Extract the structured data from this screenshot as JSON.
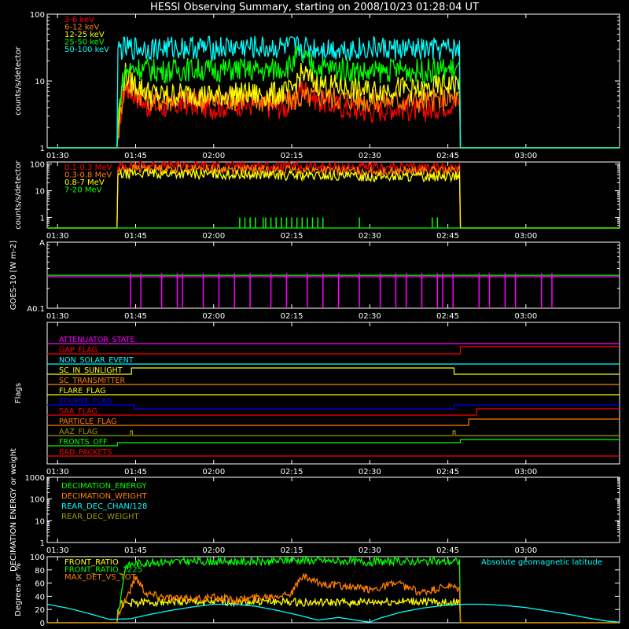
{
  "title": "HESSI Observing Summary, starting on 2008/10/23 01:28:04 UT",
  "time_axis": {
    "start_min": 88,
    "end_min": 198,
    "ticks": [
      {
        "label": "01:30",
        "min": 90
      },
      {
        "label": "01:45",
        "min": 105
      },
      {
        "label": "02:00",
        "min": 120
      },
      {
        "label": "02:15",
        "min": 135
      },
      {
        "label": "02:30",
        "min": 150
      },
      {
        "label": "02:45",
        "min": 165
      },
      {
        "label": "03:00",
        "min": 180
      }
    ]
  },
  "chart_data": [
    {
      "id": "count-rates-low",
      "type": "line",
      "ylabel": "counts/s/detector",
      "yscale": "log",
      "ylim": [
        1,
        100
      ],
      "yticks": [
        {
          "label": "1",
          "v": 1
        },
        {
          "label": "10",
          "v": 10
        },
        {
          "label": "100",
          "v": 100
        }
      ],
      "legend_placement": "top-left",
      "series": [
        {
          "name": "3-6 keV",
          "color": "#ff0000",
          "x": [
            88,
            101.5,
            101.6,
            102,
            103,
            104,
            105,
            106,
            107,
            108,
            110,
            115,
            120,
            125,
            130,
            135,
            137,
            140,
            145,
            150,
            155,
            160,
            165,
            167.3,
            167.4,
            198
          ],
          "y": [
            1,
            1,
            1.5,
            2.5,
            8,
            7,
            6,
            5.5,
            4,
            4.5,
            4,
            4.5,
            4,
            4.5,
            4.2,
            4,
            8,
            5,
            4,
            3.5,
            4,
            3.5,
            4.5,
            5,
            1,
            1
          ]
        },
        {
          "name": "6-12 keV",
          "color": "#ff7f00",
          "x": [
            88,
            101.5,
            101.6,
            102,
            103,
            104,
            105,
            107,
            110,
            115,
            120,
            125,
            130,
            135,
            140,
            145,
            150,
            155,
            160,
            165,
            167.3,
            167.4,
            198
          ],
          "y": [
            1,
            1,
            1.5,
            2.5,
            9,
            8,
            7,
            5.5,
            5,
            5.5,
            5,
            5.5,
            5,
            5.2,
            6,
            5.5,
            5,
            5.2,
            5,
            5.5,
            5.5,
            1,
            1
          ]
        },
        {
          "name": "12-25 keV",
          "color": "#ffff00",
          "x": [
            88,
            101.5,
            101.6,
            102,
            103,
            104,
            105,
            107,
            110,
            115,
            120,
            125,
            130,
            135,
            137,
            140,
            145,
            150,
            155,
            160,
            165,
            167.3,
            167.4,
            198
          ],
          "y": [
            1,
            1,
            2,
            4,
            13,
            10,
            9,
            7,
            6,
            6.5,
            6,
            6.5,
            6.2,
            7,
            13,
            9,
            8,
            7,
            8,
            7,
            9,
            9,
            1,
            1
          ]
        },
        {
          "name": "25-50 keV",
          "color": "#00ff00",
          "x": [
            88,
            101.5,
            101.6,
            102,
            103,
            104,
            105,
            107,
            110,
            115,
            120,
            125,
            130,
            135,
            136,
            137,
            140,
            145,
            150,
            155,
            160,
            165,
            167.3,
            167.4,
            198
          ],
          "y": [
            1,
            1,
            3,
            5,
            14,
            15,
            16,
            15,
            14,
            15,
            14.5,
            15,
            14,
            17,
            25,
            22,
            16,
            15,
            13,
            15,
            14,
            15,
            15,
            1,
            1
          ]
        },
        {
          "name": "50-100 keV",
          "color": "#00ffff",
          "x": [
            88,
            101.5,
            101.6,
            102,
            105,
            110,
            115,
            120,
            125,
            130,
            135,
            140,
            145,
            150,
            155,
            160,
            165,
            167.3,
            167.4,
            198
          ],
          "y": [
            1,
            1,
            30,
            30,
            31,
            31,
            32,
            31,
            32,
            31,
            32,
            31,
            30,
            31,
            30,
            29,
            30,
            30,
            1,
            1
          ]
        }
      ]
    },
    {
      "id": "count-rates-high",
      "type": "line",
      "ylabel": "counts/s/detector",
      "yscale": "log",
      "ylim": [
        0.4,
        120
      ],
      "yticks": [
        {
          "label": "1",
          "v": 1
        },
        {
          "label": "10",
          "v": 10
        },
        {
          "label": "100",
          "v": 100
        }
      ],
      "legend_placement": "top-left",
      "series": [
        {
          "name": "0.1-0.3 MeV",
          "color": "#ff0000",
          "x": [
            88,
            101.5,
            101.6,
            105,
            115,
            125,
            135,
            145,
            155,
            165,
            167.3,
            167.4,
            198
          ],
          "y": [
            0.4,
            0.4,
            80,
            92,
            90,
            87,
            82,
            76,
            72,
            76,
            78,
            0.4,
            0.4
          ]
        },
        {
          "name": "0.3-0.8 MeV",
          "color": "#ff7f00",
          "x": [
            88,
            101.5,
            101.6,
            105,
            115,
            125,
            135,
            145,
            155,
            165,
            167.3,
            167.4,
            198
          ],
          "y": [
            0.4,
            0.4,
            58,
            68,
            66,
            62,
            58,
            55,
            52,
            55,
            56,
            0.4,
            0.4
          ]
        },
        {
          "name": "0.8-7 MeV",
          "color": "#ffff00",
          "x": [
            88,
            101.5,
            101.6,
            105,
            115,
            125,
            135,
            145,
            155,
            165,
            167.3,
            167.4,
            198
          ],
          "y": [
            0.4,
            0.4,
            38,
            45,
            43,
            40,
            37,
            35,
            33,
            35,
            36,
            0.4,
            0.4
          ]
        },
        {
          "name": "7-20 MeV",
          "color": "#00ff00",
          "x": [
            88,
            198
          ],
          "y": [
            0.4,
            0.4
          ]
        }
      ],
      "spikes": {
        "color": "#00ff00",
        "y": 1,
        "x": [
          125,
          126,
          127,
          128,
          129.5,
          130,
          131,
          132,
          133,
          134,
          135,
          136,
          137,
          138,
          139,
          140,
          141,
          148,
          162,
          163
        ]
      }
    },
    {
      "id": "goes",
      "type": "line",
      "ylabel": "GOES-10 [W m-2]",
      "yscale": "log",
      "ylim": [
        0.1,
        1
      ],
      "yticks": [
        {
          "label": "A",
          "v": 1
        },
        {
          "label": "A0.1",
          "v": 0.1
        }
      ],
      "series": [
        {
          "name": "",
          "color": "#00ff00",
          "x": [
            88,
            198
          ],
          "y": [
            0.315,
            0.315
          ]
        },
        {
          "name": "",
          "color": "#ff00ff",
          "x": [
            88,
            198
          ],
          "y": [
            0.3,
            0.3
          ]
        }
      ],
      "spikes": {
        "color": "#ff00ff",
        "y": 0.34,
        "x": [
          104,
          106,
          110,
          113,
          114,
          118,
          121,
          124,
          127,
          131,
          134,
          138,
          141,
          144,
          148,
          152,
          155,
          157,
          160,
          163,
          164,
          166,
          171,
          173,
          176,
          178,
          183,
          185
        ]
      }
    },
    {
      "id": "flags",
      "type": "line",
      "ylabel": "Flags",
      "flags": [
        {
          "name": "ATTENUATOR_STATE",
          "color": "#ff00ff",
          "y": 437,
          "steps": []
        },
        {
          "name": "GAP_FLAG",
          "color": "#ff0000",
          "y": 450,
          "steps": [
            [
              167.4,
              -9
            ]
          ]
        },
        {
          "name": "NON_SOLAR_EVENT",
          "color": "#00ffff",
          "y": 463,
          "steps": []
        },
        {
          "name": "SC_IN_SUNLIGHT",
          "color": "#ffff00",
          "y": 476,
          "steps": [
            [
              104.2,
              -8
            ],
            [
              166.2,
              0
            ]
          ]
        },
        {
          "name": "SC_TRANSMITTER",
          "color": "#ff7f00",
          "y": 489,
          "steps": []
        },
        {
          "name": "FLARE_FLAG",
          "color": "#ffff00",
          "y": 502,
          "steps": []
        },
        {
          "name": "ECLIPSE_FLAG",
          "color": "#0000ff",
          "y": 515,
          "steps": [
            [
              104.7,
              5
            ],
            [
              166.2,
              0
            ]
          ]
        },
        {
          "name": "SAA_FLAG",
          "color": "#ff0000",
          "y": 528,
          "steps": [
            [
              170.5,
              -8
            ]
          ]
        },
        {
          "name": "PARTICLE_FLAG",
          "color": "#ff7f00",
          "y": 541,
          "steps": [
            [
              169,
              -8
            ]
          ]
        },
        {
          "name": "AAZ_FLAG",
          "color": "#9a9a00",
          "y": 554,
          "steps": [
            [
              104,
              -6
            ],
            [
              104.4,
              0
            ],
            [
              166,
              -6
            ],
            [
              166.4,
              0
            ]
          ]
        },
        {
          "name": "FRONTS_OFF",
          "color": "#00ff00",
          "y": 567,
          "steps": [
            [
              101.5,
              -4
            ],
            [
              167.4,
              -8
            ]
          ]
        },
        {
          "name": "BAD_PACKETS",
          "color": "#ff0000",
          "y": 580,
          "steps": []
        }
      ]
    },
    {
      "id": "decimation",
      "type": "line",
      "ylabel": "DECIMATION ENERGY or weight",
      "yscale": "log",
      "ylim": [
        1,
        1000
      ],
      "yticks": [
        {
          "label": "1",
          "v": 1
        },
        {
          "label": "10",
          "v": 10
        },
        {
          "label": "100",
          "v": 100
        },
        {
          "label": "1000",
          "v": 1000
        }
      ],
      "legend": [
        {
          "name": "DECIMATION_ENERGY",
          "color": "#00ff00"
        },
        {
          "name": "DECIMATION_WEIGHT",
          "color": "#ff7f00"
        },
        {
          "name": "REAR_DEC_CHAN/128",
          "color": "#00ffff"
        },
        {
          "name": "REAR_DEC_WEIGHT",
          "color": "#9a9a00"
        }
      ]
    },
    {
      "id": "ratios",
      "type": "line",
      "ylabel": "Degrees or %",
      "ylim": [
        0,
        100
      ],
      "yticks": [
        {
          "label": "0",
          "v": 0
        },
        {
          "label": "20",
          "v": 20
        },
        {
          "label": "40",
          "v": 40
        },
        {
          "label": "60",
          "v": 60
        },
        {
          "label": "80",
          "v": 80
        },
        {
          "label": "100",
          "v": 100
        }
      ],
      "annotation": "Absolute geomagnetic latitude",
      "series": [
        {
          "name": "FRONT_RATIO",
          "color": "#ffff00",
          "x": [
            88,
            101.5,
            101.6,
            102,
            105,
            110,
            120,
            130,
            140,
            150,
            160,
            165,
            167.3,
            167.4,
            198
          ],
          "y": [
            0,
            0,
            20,
            28,
            30,
            32,
            31,
            32,
            30,
            31,
            32,
            30,
            32,
            0,
            0
          ]
        },
        {
          "name": "FRONT_RATIO_1225",
          "color": "#00ff00",
          "x": [
            88,
            101.5,
            101.6,
            102,
            103,
            105,
            110,
            120,
            130,
            135,
            140,
            150,
            160,
            165,
            167.3,
            167.4,
            198
          ],
          "y": [
            0,
            0,
            15,
            30,
            85,
            90,
            92,
            93,
            92,
            95,
            94,
            92,
            93,
            92,
            93,
            0,
            0
          ]
        },
        {
          "name": "MAX_DET_VS_TOT",
          "color": "#ff7f00",
          "x": [
            88,
            101.5,
            101.6,
            102,
            104,
            105,
            107,
            110,
            115,
            120,
            125,
            130,
            135,
            137,
            140,
            145,
            150,
            155,
            160,
            165,
            167.3,
            167.4,
            198
          ],
          "y": [
            0,
            0,
            10,
            20,
            50,
            70,
            45,
            40,
            35,
            38,
            35,
            40,
            45,
            70,
            60,
            55,
            50,
            60,
            45,
            55,
            50,
            0,
            0
          ]
        },
        {
          "name": "",
          "color": "#00ffff",
          "x": [
            88,
            92,
            96,
            100,
            104,
            108,
            112,
            116,
            120,
            124,
            128,
            132,
            136,
            140,
            144,
            148,
            150,
            152,
            156,
            160,
            164,
            168,
            172,
            176,
            180,
            184,
            188,
            192,
            196,
            198
          ],
          "y": [
            28,
            22,
            14,
            5,
            6,
            13,
            19,
            24,
            28,
            28,
            25,
            19,
            12,
            4,
            8,
            3,
            1,
            7,
            16,
            22,
            26,
            28,
            28,
            26,
            23,
            18,
            13,
            7,
            2,
            1
          ]
        }
      ]
    }
  ]
}
